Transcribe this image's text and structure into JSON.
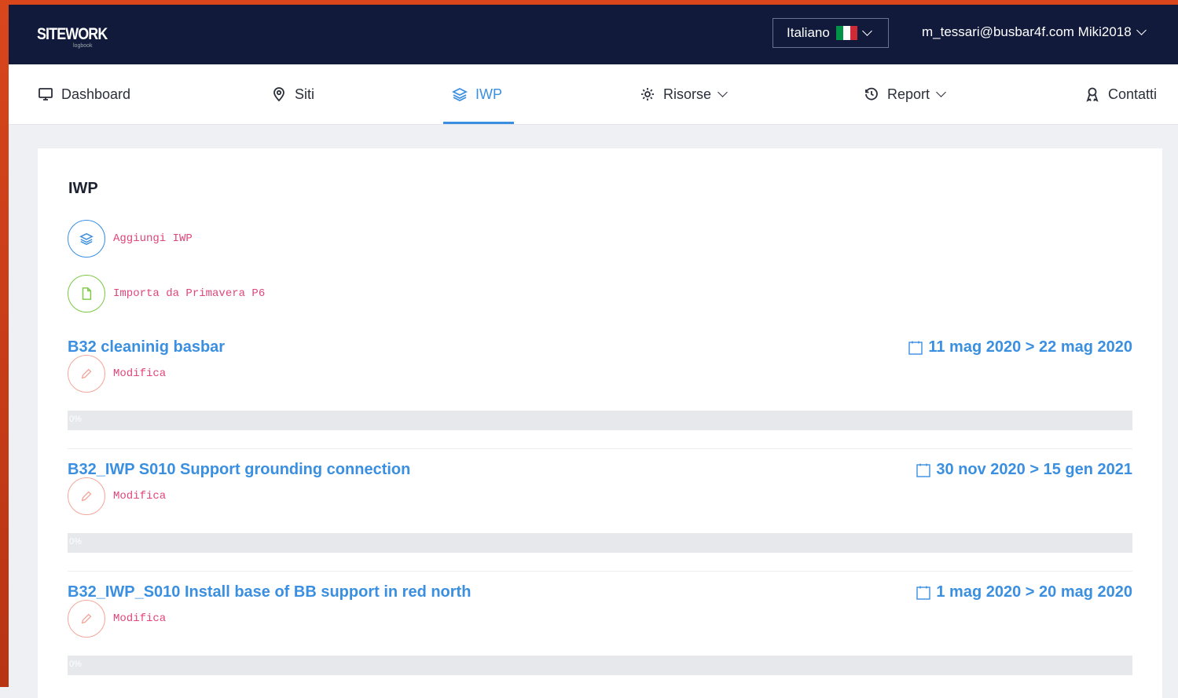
{
  "app": {
    "logo": "SITEWORK",
    "logo_sub": "logbook"
  },
  "header": {
    "language": "Italiano",
    "user": "m_tessari@busbar4f.com Miki2018",
    "flag_colors": [
      "#009246",
      "#ffffff",
      "#ce2b37"
    ]
  },
  "nav": {
    "items": [
      {
        "label": "Dashboard",
        "icon": "monitor-icon"
      },
      {
        "label": "Siti",
        "icon": "map-pin-icon"
      },
      {
        "label": "IWP",
        "icon": "layers-icon",
        "active": true
      },
      {
        "label": "Risorse",
        "icon": "gear-icon",
        "dropdown": true
      },
      {
        "label": "Report",
        "icon": "history-icon",
        "dropdown": true
      },
      {
        "label": "Contatti",
        "icon": "contacts-icon"
      }
    ]
  },
  "page": {
    "title": "IWP",
    "add_label": "Aggiungi IWP",
    "import_label": "Importa da Primavera P6"
  },
  "iwps": [
    {
      "name": "B32 cleaninig basbar",
      "dates": "11 mag 2020 > 22 mag 2020",
      "edit_label": "Modifica",
      "progress_text": "0%",
      "progress": 0
    },
    {
      "name": "B32_IWP S010 Support grounding connection",
      "dates": "30 nov 2020 > 15 gen 2021",
      "edit_label": "Modifica",
      "progress_text": "0%",
      "progress": 0
    },
    {
      "name": "B32_IWP_S010 Install base of BB support in red north",
      "dates": "1 mag 2020 > 20 mag 2020",
      "edit_label": "Modifica",
      "progress_text": "0%",
      "progress": 0
    }
  ],
  "colors": {
    "accent": "#3a8fe0",
    "action_text": "#e0457b",
    "topbar": "#111a3b",
    "frame": "#d9461c"
  }
}
